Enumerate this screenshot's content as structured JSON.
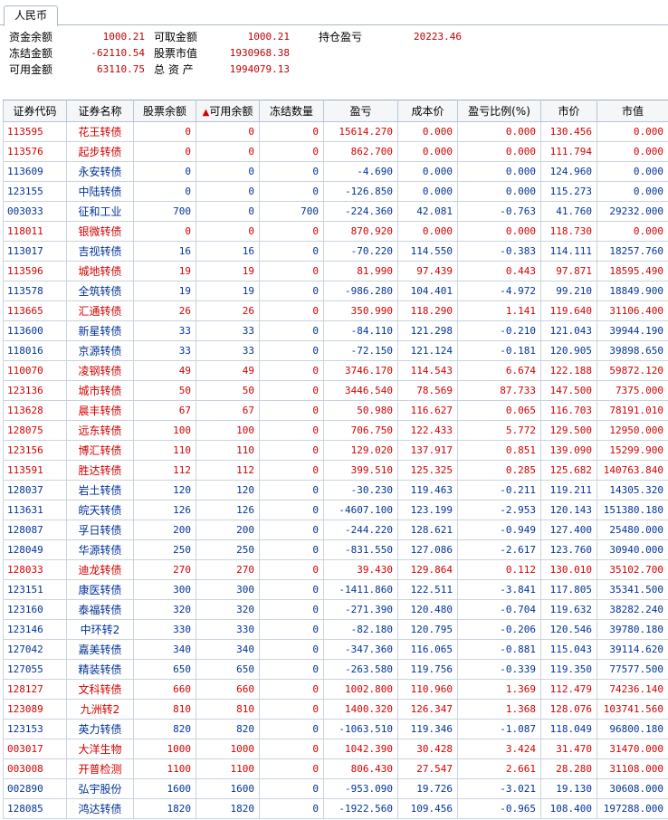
{
  "tab": {
    "label": "人民币"
  },
  "summary": {
    "fund_balance_label": "资金余额",
    "fund_balance": "1000.21",
    "withdrawable_label": "可取金额",
    "withdrawable": "1000.21",
    "position_pnl_label": "持仓盈亏",
    "position_pnl": "20223.46",
    "frozen_label": "冻结金额",
    "frozen": "-62110.54",
    "stock_value_label": "股票市值",
    "stock_value": "1930968.38",
    "available_label": "可用金额",
    "available": "63110.75",
    "total_assets_label": "总 资 产",
    "total_assets": "1994079.13"
  },
  "table": {
    "headers": [
      "证券代码",
      "证券名称",
      "股票余额",
      "可用余额",
      "冻结数量",
      "盈亏",
      "成本价",
      "盈亏比例(%)",
      "市价",
      "市值"
    ],
    "sort_indicator": "▲",
    "rows": [
      {
        "color": "red",
        "cells": [
          "113595",
          "花王转债",
          "0",
          "0",
          "0",
          "15614.270",
          "0.000",
          "0.000",
          "130.456",
          "0.000"
        ]
      },
      {
        "color": "red",
        "cells": [
          "113576",
          "起步转债",
          "0",
          "0",
          "0",
          "862.700",
          "0.000",
          "0.000",
          "111.794",
          "0.000"
        ]
      },
      {
        "color": "blue",
        "cells": [
          "113609",
          "永安转债",
          "0",
          "0",
          "0",
          "-4.690",
          "0.000",
          "0.000",
          "124.960",
          "0.000"
        ]
      },
      {
        "color": "blue",
        "cells": [
          "123155",
          "中陆转债",
          "0",
          "0",
          "0",
          "-126.850",
          "0.000",
          "0.000",
          "115.273",
          "0.000"
        ]
      },
      {
        "color": "blue",
        "cells": [
          "003033",
          "征和工业",
          "700",
          "0",
          "700",
          "-224.360",
          "42.081",
          "-0.763",
          "41.760",
          "29232.000"
        ]
      },
      {
        "color": "red",
        "cells": [
          "118011",
          "银微转债",
          "0",
          "0",
          "0",
          "870.920",
          "0.000",
          "0.000",
          "118.730",
          "0.000"
        ]
      },
      {
        "color": "blue",
        "cells": [
          "113017",
          "吉视转债",
          "16",
          "16",
          "0",
          "-70.220",
          "114.550",
          "-0.383",
          "114.111",
          "18257.760"
        ]
      },
      {
        "color": "red",
        "cells": [
          "113596",
          "城地转债",
          "19",
          "19",
          "0",
          "81.990",
          "97.439",
          "0.443",
          "97.871",
          "18595.490"
        ]
      },
      {
        "color": "blue",
        "cells": [
          "113578",
          "全筑转债",
          "19",
          "19",
          "0",
          "-986.280",
          "104.401",
          "-4.972",
          "99.210",
          "18849.900"
        ]
      },
      {
        "color": "red",
        "cells": [
          "113665",
          "汇通转债",
          "26",
          "26",
          "0",
          "350.990",
          "118.290",
          "1.141",
          "119.640",
          "31106.400"
        ]
      },
      {
        "color": "blue",
        "cells": [
          "113600",
          "新星转债",
          "33",
          "33",
          "0",
          "-84.110",
          "121.298",
          "-0.210",
          "121.043",
          "39944.190"
        ]
      },
      {
        "color": "blue",
        "cells": [
          "118016",
          "京源转债",
          "33",
          "33",
          "0",
          "-72.150",
          "121.124",
          "-0.181",
          "120.905",
          "39898.650"
        ]
      },
      {
        "color": "red",
        "cells": [
          "110070",
          "凌钢转债",
          "49",
          "49",
          "0",
          "3746.170",
          "114.543",
          "6.674",
          "122.188",
          "59872.120"
        ]
      },
      {
        "color": "red",
        "cells": [
          "123136",
          "城市转债",
          "50",
          "50",
          "0",
          "3446.540",
          "78.569",
          "87.733",
          "147.500",
          "7375.000"
        ]
      },
      {
        "color": "red",
        "cells": [
          "113628",
          "晨丰转债",
          "67",
          "67",
          "0",
          "50.980",
          "116.627",
          "0.065",
          "116.703",
          "78191.010"
        ]
      },
      {
        "color": "red",
        "cells": [
          "128075",
          "远东转债",
          "100",
          "100",
          "0",
          "706.750",
          "122.433",
          "5.772",
          "129.500",
          "12950.000"
        ]
      },
      {
        "color": "red",
        "cells": [
          "123156",
          "博汇转债",
          "110",
          "110",
          "0",
          "129.020",
          "137.917",
          "0.851",
          "139.090",
          "15299.900"
        ]
      },
      {
        "color": "red",
        "cells": [
          "113591",
          "胜达转债",
          "112",
          "112",
          "0",
          "399.510",
          "125.325",
          "0.285",
          "125.682",
          "140763.840"
        ]
      },
      {
        "color": "blue",
        "cells": [
          "128037",
          "岩土转债",
          "120",
          "120",
          "0",
          "-30.230",
          "119.463",
          "-0.211",
          "119.211",
          "14305.320"
        ]
      },
      {
        "color": "blue",
        "cells": [
          "113631",
          "皖天转债",
          "126",
          "126",
          "0",
          "-4607.100",
          "123.199",
          "-2.953",
          "120.143",
          "151380.180"
        ]
      },
      {
        "color": "blue",
        "cells": [
          "128087",
          "孚日转债",
          "200",
          "200",
          "0",
          "-244.220",
          "128.621",
          "-0.949",
          "127.400",
          "25480.000"
        ]
      },
      {
        "color": "blue",
        "cells": [
          "128049",
          "华源转债",
          "250",
          "250",
          "0",
          "-831.550",
          "127.086",
          "-2.617",
          "123.760",
          "30940.000"
        ]
      },
      {
        "color": "red",
        "cells": [
          "128033",
          "迪龙转债",
          "270",
          "270",
          "0",
          "39.430",
          "129.864",
          "0.112",
          "130.010",
          "35102.700"
        ]
      },
      {
        "color": "blue",
        "cells": [
          "123151",
          "康医转债",
          "300",
          "300",
          "0",
          "-1411.860",
          "122.511",
          "-3.841",
          "117.805",
          "35341.500"
        ]
      },
      {
        "color": "blue",
        "cells": [
          "123160",
          "泰福转债",
          "320",
          "320",
          "0",
          "-271.390",
          "120.480",
          "-0.704",
          "119.632",
          "38282.240"
        ]
      },
      {
        "color": "blue",
        "cells": [
          "123146",
          "中环转2",
          "330",
          "330",
          "0",
          "-82.180",
          "120.795",
          "-0.206",
          "120.546",
          "39780.180"
        ]
      },
      {
        "color": "blue",
        "cells": [
          "127042",
          "嘉美转债",
          "340",
          "340",
          "0",
          "-347.360",
          "116.065",
          "-0.881",
          "115.043",
          "39114.620"
        ]
      },
      {
        "color": "blue",
        "cells": [
          "127055",
          "精装转债",
          "650",
          "650",
          "0",
          "-263.580",
          "119.756",
          "-0.339",
          "119.350",
          "77577.500"
        ]
      },
      {
        "color": "red",
        "cells": [
          "128127",
          "文科转债",
          "660",
          "660",
          "0",
          "1002.800",
          "110.960",
          "1.369",
          "112.479",
          "74236.140"
        ]
      },
      {
        "color": "red",
        "cells": [
          "123089",
          "九洲转2",
          "810",
          "810",
          "0",
          "1400.320",
          "126.347",
          "1.368",
          "128.076",
          "103741.560"
        ]
      },
      {
        "color": "blue",
        "cells": [
          "123153",
          "英力转债",
          "820",
          "820",
          "0",
          "-1063.510",
          "119.346",
          "-1.087",
          "118.049",
          "96800.180"
        ]
      },
      {
        "color": "red",
        "cells": [
          "003017",
          "大洋生物",
          "1000",
          "1000",
          "0",
          "1042.390",
          "30.428",
          "3.424",
          "31.470",
          "31470.000"
        ]
      },
      {
        "color": "red",
        "cells": [
          "003008",
          "开普检测",
          "1100",
          "1100",
          "0",
          "806.430",
          "27.547",
          "2.661",
          "28.280",
          "31108.000"
        ]
      },
      {
        "color": "blue",
        "cells": [
          "002890",
          "弘宇股份",
          "1600",
          "1600",
          "0",
          "-953.090",
          "19.726",
          "-3.021",
          "19.130",
          "30608.000"
        ]
      },
      {
        "color": "blue",
        "cells": [
          "128085",
          "鸿达转债",
          "1820",
          "1820",
          "0",
          "-1922.560",
          "109.456",
          "-0.965",
          "108.400",
          "197288.000"
        ]
      }
    ]
  }
}
